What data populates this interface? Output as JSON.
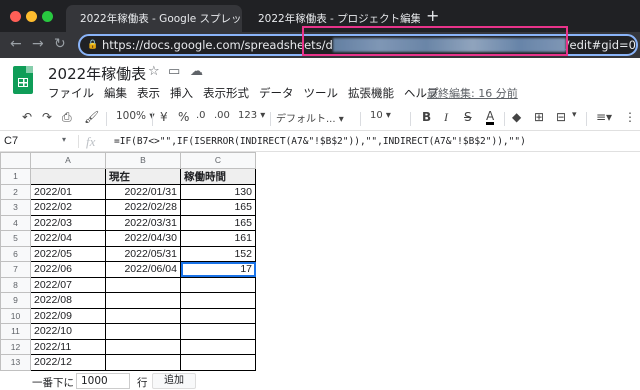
{
  "browser": {
    "tabs": [
      {
        "title": "2022年稼働表 - Google スプレッ",
        "active": true
      },
      {
        "title": "2022年稼働表 - プロジェクト編集",
        "active": false
      }
    ],
    "new_tab": "+",
    "url_prefix": "https://docs.google.com/spreadsheets/d",
    "url_suffix": "edit#gid=0"
  },
  "doc": {
    "title": "2022年稼働表",
    "menu": [
      "ファイル",
      "編集",
      "表示",
      "挿入",
      "表示形式",
      "データ",
      "ツール",
      "拡張機能",
      "ヘルプ"
    ],
    "last_edit": "最終編集: 16 分前"
  },
  "toolbar": {
    "zoom": "100%",
    "currency": "¥",
    "percent": "%",
    "dec_less": ".0",
    "dec_more": ".00",
    "number_format": "123",
    "font": "デフォルト...",
    "font_size": "10",
    "bold": "B",
    "italic": "I",
    "strike": "S",
    "text_color": "A"
  },
  "formula_bar": {
    "cell": "C7",
    "fx": "fx",
    "formula": "=IF(B7<>\"\",IF(ISERROR(INDIRECT(A7&\"!$B$2\")),\"\",INDIRECT(A7&\"!$B$2\")),\"\")"
  },
  "grid": {
    "columns": [
      "A",
      "B",
      "C"
    ],
    "rows": [
      {
        "n": "1",
        "a": "",
        "b": "現在",
        "c": ""
      },
      {
        "n": "2",
        "a": "2022/01",
        "b": "2022/01/31",
        "c": "130"
      },
      {
        "n": "3",
        "a": "2022/02",
        "b": "2022/02/28",
        "c": "165"
      },
      {
        "n": "4",
        "a": "2022/03",
        "b": "2022/03/31",
        "c": "165"
      },
      {
        "n": "5",
        "a": "2022/04",
        "b": "2022/04/30",
        "c": "161"
      },
      {
        "n": "6",
        "a": "2022/05",
        "b": "2022/05/31",
        "c": "152"
      },
      {
        "n": "7",
        "a": "2022/06",
        "b": "2022/06/04",
        "c": "17"
      },
      {
        "n": "8",
        "a": "2022/07",
        "b": "",
        "c": ""
      },
      {
        "n": "9",
        "a": "2022/08",
        "b": "",
        "c": ""
      },
      {
        "n": "10",
        "a": "2022/09",
        "b": "",
        "c": ""
      },
      {
        "n": "11",
        "a": "2022/10",
        "b": "",
        "c": ""
      },
      {
        "n": "12",
        "a": "2022/11",
        "b": "",
        "c": ""
      },
      {
        "n": "13",
        "a": "2022/12",
        "b": "",
        "c": ""
      }
    ],
    "c1_header": "稼働時間"
  },
  "bottom": {
    "label": "一番下に",
    "rows_value": "1000",
    "rows_label": "行",
    "add_label": "追加"
  },
  "colors": {
    "accent": "#1a73e8",
    "highlight": "#e8338a",
    "sheets_green": "#0f9d58"
  }
}
